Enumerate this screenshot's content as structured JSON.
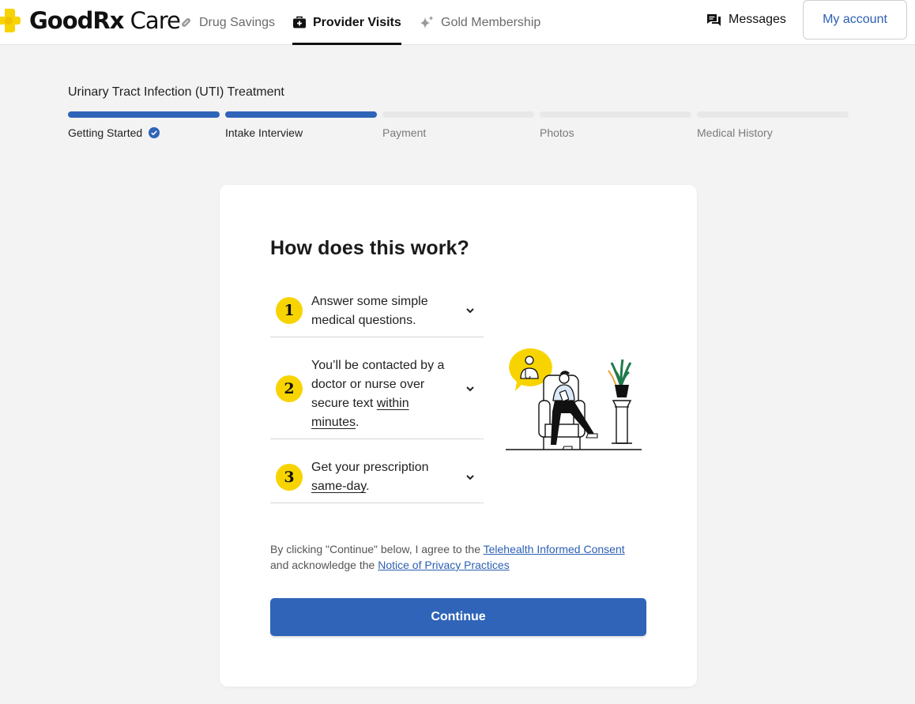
{
  "brand": {
    "name_bold": "GoodRx",
    "name_light": " Care",
    "color": "#f7d400"
  },
  "nav": {
    "items": [
      {
        "label": "Drug Savings",
        "icon": "pill-icon"
      },
      {
        "label": "Provider Visits",
        "icon": "medical-bag-icon",
        "active": true
      },
      {
        "label": "Gold Membership",
        "icon": "sparkle-icon"
      }
    ],
    "messages_label": "Messages",
    "account_label": "My account"
  },
  "flow": {
    "title": "Urinary Tract Infection (UTI) Treatment",
    "steps": [
      {
        "label": "Getting Started",
        "complete": true
      },
      {
        "label": "Intake Interview",
        "complete": true
      },
      {
        "label": "Payment",
        "complete": false
      },
      {
        "label": "Photos",
        "complete": false
      },
      {
        "label": "Medical History",
        "complete": false
      }
    ]
  },
  "card": {
    "heading": "How does this work?",
    "steps": [
      {
        "number": "1",
        "text_lines": [
          "Answer some simple",
          "medical questions."
        ]
      },
      {
        "number": "2",
        "text_pre": "You’ll be contacted by a doctor or nurse over secure text ",
        "text_underline": "within minutes",
        "text_post": "."
      },
      {
        "number": "3",
        "text_pre": "Get your prescription ",
        "text_underline": "same-day",
        "text_post": "."
      }
    ],
    "consent": {
      "pre": "By clicking \"Continue\" below, I agree to the ",
      "link1": "Telehealth Informed Consent",
      "mid": " and acknowledge the ",
      "link2": "Notice of Privacy Practices"
    },
    "continue_label": "Continue"
  },
  "colors": {
    "primary": "#2f64b8",
    "accent_yellow": "#f7d400",
    "link": "#2c5fb3"
  }
}
